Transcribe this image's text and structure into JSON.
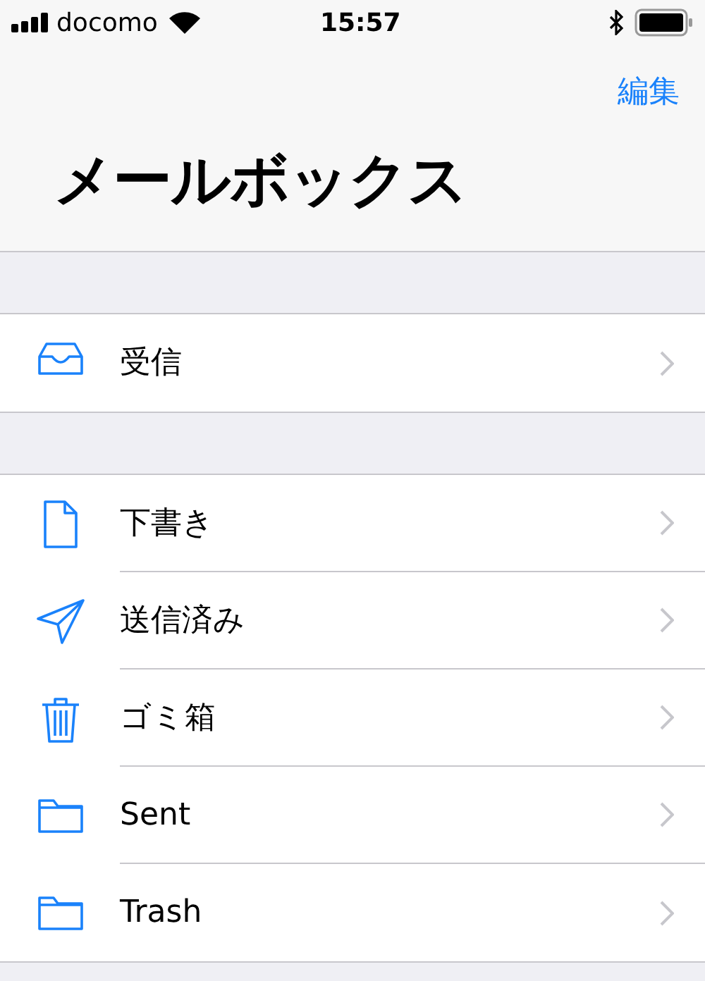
{
  "status_bar": {
    "carrier": "docomo",
    "time": "15:57"
  },
  "nav": {
    "edit_button": "編集",
    "title": "メールボックス"
  },
  "sections": [
    {
      "items": [
        {
          "kind": "inbox",
          "label": "受信"
        }
      ]
    },
    {
      "items": [
        {
          "kind": "draft",
          "label": "下書き"
        },
        {
          "kind": "sent",
          "label": "送信済み"
        },
        {
          "kind": "trash",
          "label": "ゴミ箱"
        },
        {
          "kind": "folder",
          "label": "Sent"
        },
        {
          "kind": "folder",
          "label": "Trash"
        }
      ]
    }
  ]
}
